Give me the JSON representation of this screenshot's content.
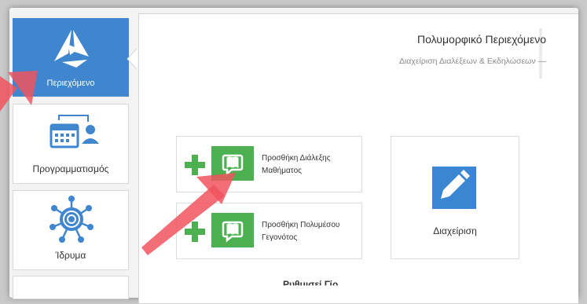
{
  "sidebar": {
    "items": [
      {
        "label": "Περιεχόμενο",
        "icon": "content-logo-icon",
        "active": true
      },
      {
        "label": "Προγραμματισμός",
        "icon": "calendar-user-icon",
        "active": false
      },
      {
        "label": "Ίδρυμα",
        "icon": "institution-network-icon",
        "active": false
      }
    ]
  },
  "panel": {
    "title": "Πολυμορφικό Περιεχόμενο",
    "subtitle": "Διαχείριση Διαλέξεων & Εκδηλώσεων —"
  },
  "actions": {
    "add_lecture": "Προσθήκη Διάλεξης Μαθήματος",
    "add_event": "Προσθήκη Πολυμέσου Γεγονότος",
    "manage": "Διαχείριση"
  },
  "footer": {
    "partial_heading": "Ρυθμισεί Γίρ..."
  },
  "colors": {
    "accent_blue": "#3f86cf",
    "action_green": "#4caf50",
    "arrow_red": "#f0545e"
  }
}
